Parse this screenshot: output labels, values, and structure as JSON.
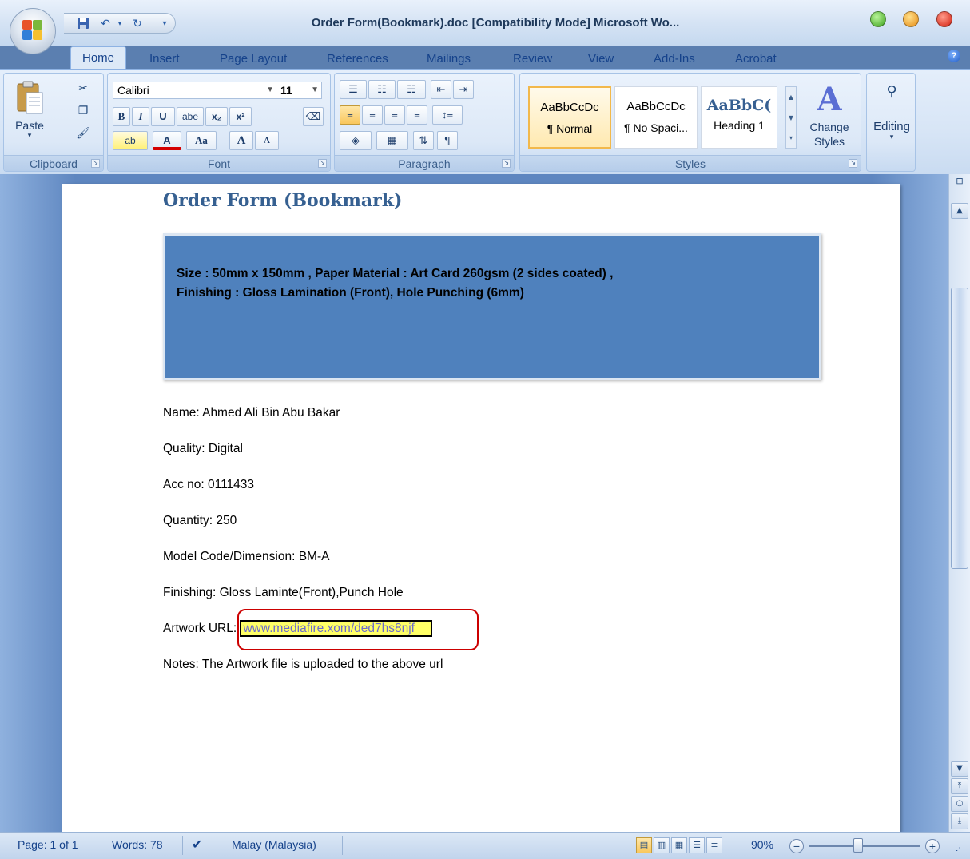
{
  "window": {
    "title": "Order Form(Bookmark).doc [Compatibility Mode] Microsoft Wo...",
    "controls": [
      "minimize-icon",
      "maximize-icon",
      "close-icon"
    ]
  },
  "quick_access": {
    "items": [
      "save-icon",
      "undo-icon",
      "redo-icon",
      "customize-icon"
    ]
  },
  "tabs": [
    "Home",
    "Insert",
    "Page Layout",
    "References",
    "Mailings",
    "Review",
    "View",
    "Add-Ins",
    "Acrobat"
  ],
  "active_tab": "Home",
  "ribbon": {
    "clipboard": {
      "label": "Clipboard",
      "paste_label": "Paste"
    },
    "font": {
      "label": "Font",
      "family": "Calibri",
      "size": "11",
      "bold": "B",
      "italic": "I",
      "underline": "U",
      "strike": "abe",
      "subscript": "x₂",
      "superscript": "x²",
      "change_case": "Aa",
      "grow": "A",
      "shrink": "A",
      "font_color": "A",
      "highlight": "ab"
    },
    "paragraph": {
      "label": "Paragraph"
    },
    "styles": {
      "label": "Styles",
      "tiles": [
        {
          "sample": "AaBbCcDc",
          "name": "¶ Normal"
        },
        {
          "sample": "AaBbCcDc",
          "name": "¶ No Spaci..."
        },
        {
          "sample": "AaBbC(",
          "name": "Heading 1"
        }
      ],
      "change_styles": "Change Styles"
    },
    "editing": {
      "label": "Editing"
    }
  },
  "document": {
    "title": "Order Form (Bookmark)",
    "spec_text": "Size : 50mm x 150mm , Paper Material : Art Card 260gsm (2 sides coated) , Finishing : Gloss Lamination (Front), Hole Punching (6mm)",
    "fields": {
      "name": "Name: Ahmed Ali Bin Abu Bakar",
      "quality": "Quality: Digital",
      "acc_no": "Acc no: 0111433",
      "quantity": "Quantity: 250",
      "model": "Model Code/Dimension: BM-A",
      "finishing": "Finishing: Gloss Laminte(Front),Punch Hole",
      "artwork_label": "Artwork URL: ",
      "artwork_url": "www.mediafire.xom/ded7hs8njf",
      "notes": "Notes: The Artwork file is uploaded to the above url"
    }
  },
  "status_bar": {
    "page": "Page: 1 of 1",
    "words": "Words: 78",
    "language": "Malay (Malaysia)",
    "zoom": "90%"
  },
  "colors": {
    "spec_box": "#4f81bd",
    "title": "#366091",
    "annotation": "#cc0000",
    "highlight": "#ffff66"
  }
}
